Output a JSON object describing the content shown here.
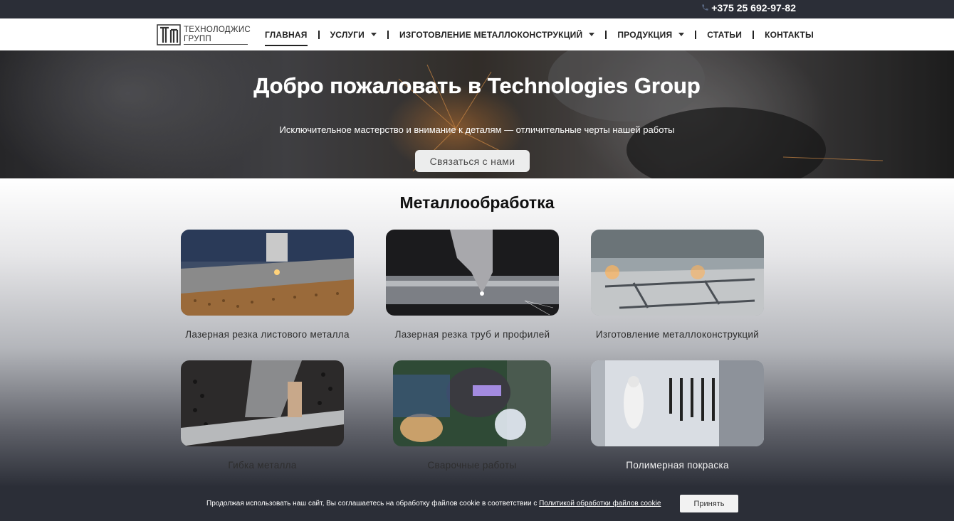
{
  "topbar": {
    "phone": "+375 25 692-97-82",
    "phone_icon": "phone-icon"
  },
  "logo": {
    "line1": "ТЕХНОЛОДЖИС",
    "line2": "ГРУПП"
  },
  "nav": {
    "items": [
      {
        "label": "ГЛАВНАЯ",
        "active": true,
        "dropdown": false
      },
      {
        "label": "УСЛУГИ",
        "dropdown": true
      },
      {
        "label": "ИЗГОТОВЛЕНИЕ МЕТАЛЛОКОНСТРУКЦИЙ",
        "dropdown": true
      },
      {
        "label": "ПРОДУКЦИЯ",
        "dropdown": true
      },
      {
        "label": "СТАТЬИ",
        "dropdown": false
      },
      {
        "label": "КОНТАКТЫ",
        "dropdown": false
      }
    ]
  },
  "hero": {
    "title": "Добро пожаловать в Technologies Group",
    "subtitle": "Исключительное мастерство и внимание к деталям — отличительные черты нашей работы",
    "button": "Связаться с нами"
  },
  "services": {
    "title": "Металлообработка",
    "cards": [
      {
        "label": "Лазерная резка листового металла"
      },
      {
        "label": "Лазерная резка труб и профилей"
      },
      {
        "label": "Изготовление металлоконструкций"
      },
      {
        "label": "Гибка металла"
      },
      {
        "label": "Сварочные работы"
      },
      {
        "label": "Полимерная покраска"
      }
    ]
  },
  "cookie": {
    "text": "Продолжая использовать наш сайт, Вы соглашаетесь на обработку файлов cookie в соответствии с ",
    "link": "Политикой обработки файлов cookie",
    "button": "Принять"
  }
}
